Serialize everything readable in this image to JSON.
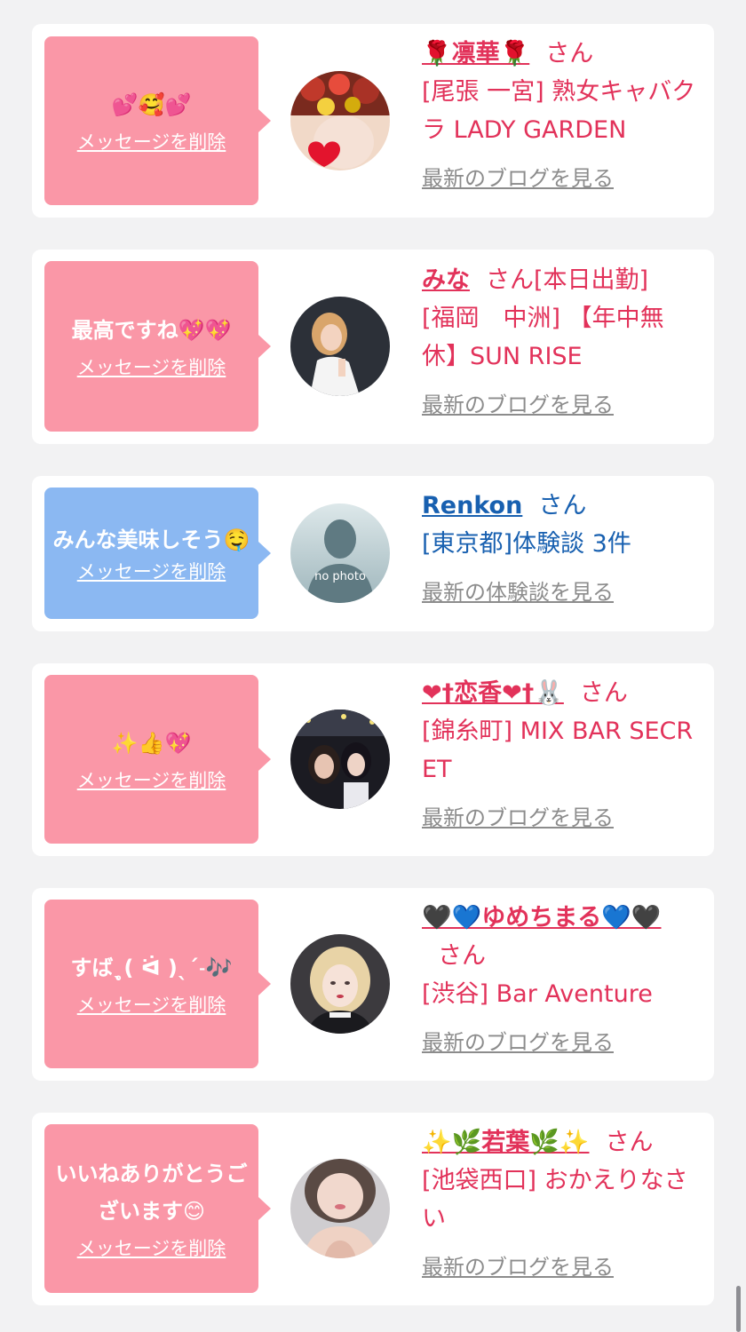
{
  "items": [
    {
      "message": "💕🥰💕",
      "bubble_color": "pink",
      "delete_label": "メッセージを削除",
      "name": "🌹凛華🌹",
      "san": "さん",
      "name_suffix": "",
      "shop": "[尾張 一宮] 熟女キャバクラ LADY GARDEN",
      "latest_label": "最新のブログを見る",
      "text_color": "pink",
      "avatar": "avatar-red-flowers"
    },
    {
      "message": "最高ですね💖💖",
      "bubble_color": "pink",
      "delete_label": "メッセージを削除",
      "name": "みな",
      "san": "さん",
      "name_suffix": "[本日出勤]",
      "shop": "[福岡　中洲] 【年中無休】SUN RISE",
      "latest_label": "最新のブログを見る",
      "text_color": "pink",
      "avatar": "avatar-woman-white-dress"
    },
    {
      "message": "みんな美味しそう🤤",
      "bubble_color": "blue",
      "delete_label": "メッセージを削除",
      "name": "Renkon",
      "san": "さん",
      "name_suffix": "",
      "shop": "[東京都]体験談 3件",
      "latest_label": "最新の体験談を見る",
      "text_color": "blue",
      "avatar": "avatar-no-photo",
      "avatar_text": "no photo"
    },
    {
      "message": "✨👍💖",
      "bubble_color": "pink",
      "delete_label": "メッセージを削除",
      "name": "❤︎†恋香❤︎†🐰",
      "san": "さん",
      "name_suffix": "",
      "shop": "[錦糸町] MIX BAR SECRET",
      "latest_label": "最新のブログを見る",
      "text_color": "pink",
      "avatar": "avatar-dark-bar"
    },
    {
      "message": "すばˎ̥(  ᐛ )ˎˊ˗🎶",
      "bubble_color": "pink",
      "delete_label": "メッセージを削除",
      "name": "🖤💙ゆめちまる💙🖤",
      "san": "さん",
      "name_suffix": "",
      "shop": "[渋谷] Bar Aventure",
      "latest_label": "最新のブログを見る",
      "text_color": "pink",
      "avatar": "avatar-blonde-girl"
    },
    {
      "message": "いいねありがとうございます😊",
      "bubble_color": "pink",
      "delete_label": "メッセージを削除",
      "name": "✨🌿若葉🌿✨",
      "san": "さん",
      "name_suffix": "",
      "shop": "[池袋西口] おかえりなさい",
      "latest_label": "最新のブログを見る",
      "text_color": "pink",
      "avatar": "avatar-selfie"
    }
  ]
}
